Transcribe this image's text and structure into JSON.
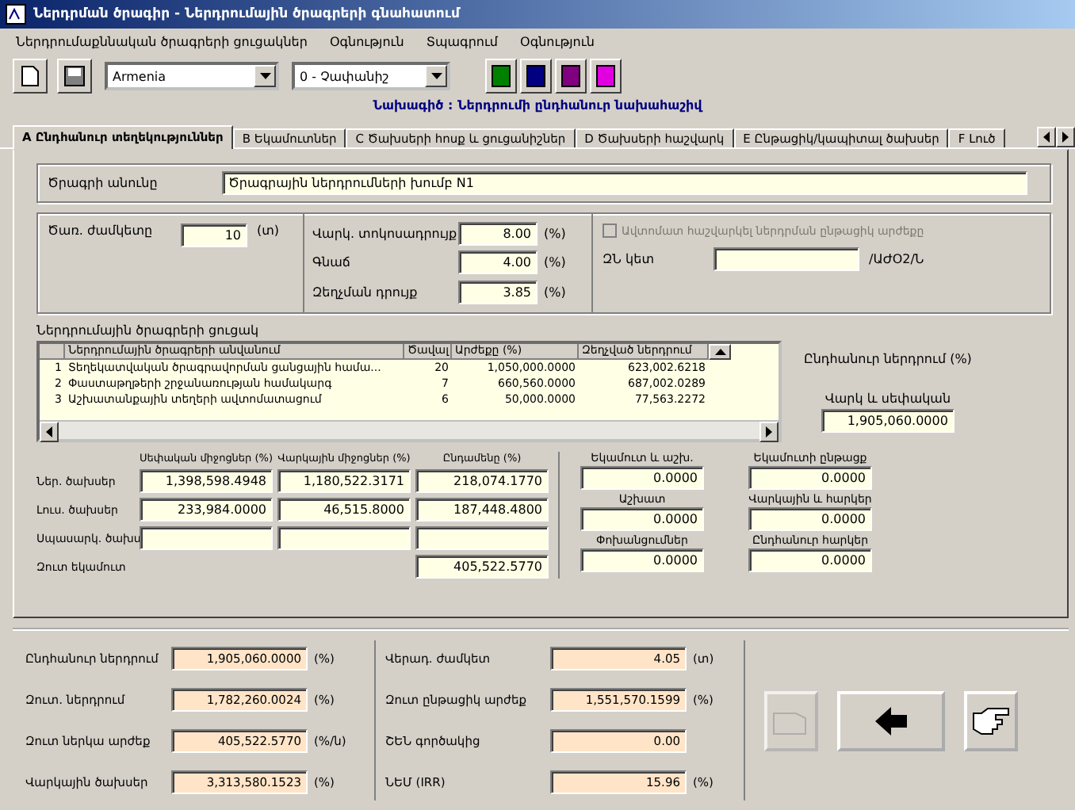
{
  "window": {
    "title": "Ներդրման ծրագիր - Ներդրումային ծրագրերի գնահատում"
  },
  "menu": [
    "Ներդրումաքննական ծրագրերի ցուցակներ",
    "Օգնություն",
    "Տպագրում",
    "Օգնություն"
  ],
  "toolbar": {
    "country": "Armenia",
    "scenario": "0 - Չափանիշ",
    "colors": [
      {
        "color": "#008000"
      },
      {
        "color": "#000080"
      },
      {
        "color": "#800080"
      },
      {
        "color": "#e000e0"
      }
    ]
  },
  "heading": "Նախագիծ : Ներդրումի ընդհանուր նախահաշիվ",
  "tabs": [
    {
      "label": "A Ընդհանուր տեղեկություններ",
      "selected": true
    },
    {
      "label": "B Եկամուտներ",
      "selected": false
    },
    {
      "label": "C Ծախսերի հոսք և ցուցանիշներ",
      "selected": false
    },
    {
      "label": "D Ծախսերի հաշվարկ",
      "selected": false
    },
    {
      "label": "E Ընթացիկ/կապիտալ ծախսեր",
      "selected": false
    },
    {
      "label": "F Լուծ",
      "selected": false
    }
  ],
  "project": {
    "label": "Ծրագրի անունը",
    "value": "Ծրագրային ներդրումների խումբ N1"
  },
  "params": {
    "term": {
      "label": "Ծառ. ժամկետը",
      "value": "10",
      "unit": "(տ)"
    },
    "rates": [
      {
        "label": "Վարկ. տոկոսադրույք",
        "value": "8.00",
        "unit": "(%)"
      },
      {
        "label": "Գնաճ",
        "value": "4.00",
        "unit": "(%)"
      },
      {
        "label": "Զեղչման դրույք",
        "value": "3.85",
        "unit": "(%)"
      }
    ],
    "auto": {
      "label": "Ավտոմատ հաշվարկել ներդրման ընթացիկ արժեքը",
      "checked": false,
      "disabled": true
    },
    "point": {
      "label": "ԶՆ կետ",
      "unit": "/ԱԺՕ2/Ն"
    }
  },
  "programs": {
    "title": "Ներդրումային ծրագրերի ցուցակ",
    "columns": [
      "Ներդրումային ծրագրերի անվանում",
      "Ծավալ",
      "Արժեքը (%)",
      "Զեղչված ներդրում"
    ],
    "rows": [
      {
        "number": "1",
        "cells": [
          "Տեղեկատվական ծրագրավորման ցանցային համա...",
          "20",
          "1,050,000.0000",
          "623,002.6218"
        ]
      },
      {
        "number": "2",
        "cells": [
          "Փաստաթղթերի շրջանառության համակարգ",
          "7",
          "660,560.0000",
          "687,002.0289"
        ]
      },
      {
        "number": "3",
        "cells": [
          "Աշխատանքային տեղերի ավտոմատացում",
          "6",
          "50,000.0000",
          "77,563.2272"
        ]
      }
    ]
  },
  "total_investment": {
    "label": "Ընդհանուր ներդրում (%)",
    "sublabel": "Վարկ և սեփական",
    "value": "1,905,060.0000"
  },
  "costs": {
    "columns": [
      "Սեփական միջոցներ (%)",
      "Վարկային միջոցներ (%)",
      "Ընդամենը (%)"
    ],
    "rows": [
      {
        "label": "Ներ. ծախսեր",
        "values": [
          "1,398,598.4948",
          "1,180,522.3171",
          "218,074.1770"
        ]
      },
      {
        "label": "Լուս. ծախսեր",
        "values": [
          "233,984.0000",
          "46,515.8000",
          "187,448.4800"
        ]
      },
      {
        "label": "Սպասարկ. ծախս",
        "kind": "blank"
      },
      {
        "label": "Զուտ եկամուտ",
        "kind": "total",
        "values": [
          "405,522.5770"
        ]
      }
    ]
  },
  "extras": [
    {
      "label": "Եկամուտ և աշխ.",
      "value": "0.0000"
    },
    {
      "label": "Եկամուտի ընթացք",
      "value": "0.0000"
    },
    {
      "label": "Աշխատ",
      "value": "0.0000"
    },
    {
      "label": "Վարկային և հարկեր",
      "value": "0.0000"
    },
    {
      "label": "Փոխանցումներ",
      "value": "0.0000"
    },
    {
      "label": "Ընդհանուր հարկեր",
      "value": "0.0000"
    }
  ],
  "summary_left": [
    {
      "label": "Ընդհանուր ներդրում",
      "value": "1,905,060.0000",
      "unit": "(%)"
    },
    {
      "label": "Զուտ. ներդրում",
      "value": "1,782,260.0024",
      "unit": "(%)"
    },
    {
      "label": "Զուտ ներկա արժեք",
      "value": "405,522.5770",
      "unit": "(%/ն)"
    },
    {
      "label": "Վարկային ծախսեր",
      "value": "3,313,580.1523",
      "unit": "(%)"
    }
  ],
  "summary_right": [
    {
      "label": "Վերադ. ժամկետ",
      "value": "4.05",
      "unit": "(տ)"
    },
    {
      "label": "Զուտ ընթացիկ արժեք",
      "value": "1,551,570.1599",
      "unit": "(%)"
    },
    {
      "label": "ՇԵՆ գործակից",
      "value": "0.00"
    },
    {
      "label": "ՆԵՄ (IRR)",
      "value": "15.96",
      "unit": "(%)"
    }
  ],
  "buttons": [
    {
      "kind": "print",
      "disabled": true
    },
    {
      "kind": "back",
      "disabled": false
    },
    {
      "kind": "exit",
      "disabled": false
    }
  ]
}
